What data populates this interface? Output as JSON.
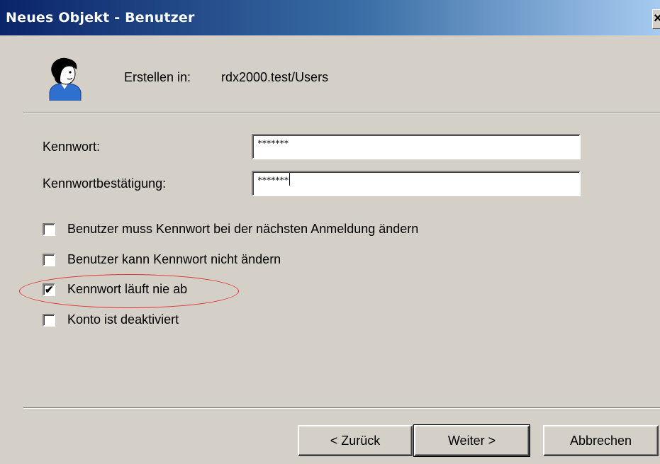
{
  "window": {
    "title": "Neues Objekt - Benutzer",
    "close_glyph": "×"
  },
  "header": {
    "icon": "user-icon",
    "create_in_label": "Erstellen in:",
    "create_in_path": "rdx2000.test/Users"
  },
  "form": {
    "password_label": "Kennwort:",
    "password_value": "∗∗∗∗∗∗∗",
    "confirm_label": "Kennwortbestätigung:",
    "confirm_value": "∗∗∗∗∗∗∗"
  },
  "options": [
    {
      "label": "Benutzer muss Kennwort bei der nächsten Anmeldung ändern",
      "checked": false
    },
    {
      "label": "Benutzer kann Kennwort nicht ändern",
      "checked": false
    },
    {
      "label": "Kennwort läuft nie ab",
      "checked": true
    },
    {
      "label": "Konto ist deaktiviert",
      "checked": false
    }
  ],
  "annotation": {
    "highlight_color": "#e03030"
  },
  "buttons": {
    "back": "< Zurück",
    "next": "Weiter >",
    "cancel": "Abbrechen"
  },
  "colors": {
    "dialog_bg": "#d4d0c8",
    "titlebar_start": "#0a246a",
    "titlebar_end": "#a6caf0"
  }
}
